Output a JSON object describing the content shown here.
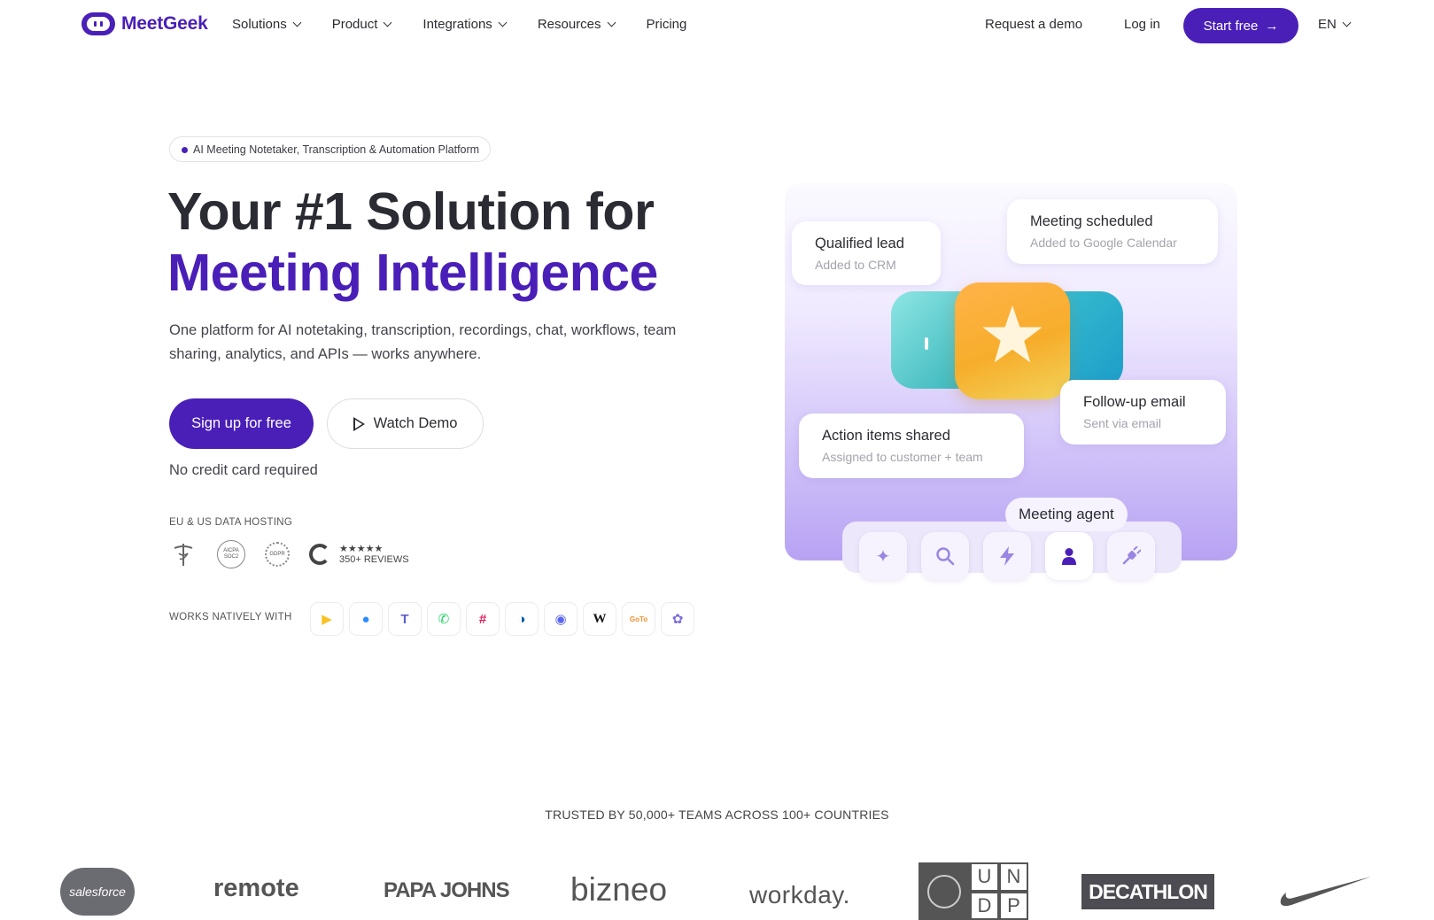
{
  "nav": {
    "brand": "MeetGeek",
    "menu": [
      {
        "label": "Solutions",
        "has_dropdown": true
      },
      {
        "label": "Product",
        "has_dropdown": true
      },
      {
        "label": "Integrations",
        "has_dropdown": true
      },
      {
        "label": "Resources",
        "has_dropdown": true
      },
      {
        "label": "Pricing",
        "has_dropdown": false
      }
    ],
    "request_demo": "Request a demo",
    "login": "Log in",
    "start_free": "Start free",
    "start_free_arrow": "→",
    "language": "EN"
  },
  "hero": {
    "pill": "AI Meeting Notetaker, Transcription & Automation Platform",
    "title_line1": "Your #1 Solution for",
    "title_line2": "Meeting Intelligence",
    "subtitle": "One platform for AI notetaking, transcription, recordings, chat, workflows, team sharing, analytics, and APIs — works anywhere.",
    "signup_button": "Sign up for free",
    "demo_button": "Watch Demo",
    "no_credit_card": "No credit card required",
    "hosting_label": "EU & US DATA HOSTING",
    "badges": {
      "hipaa": "HIPAA",
      "aicpa_line1": "AICPA",
      "aicpa_line2": "SOC2",
      "gdpr": "GDPR",
      "g2_stars": "★★★★★",
      "g2_reviews": "350+ REVIEWS"
    },
    "works_label": "WORKS NATIVELY WITH",
    "apps": [
      {
        "name": "google-meet",
        "glyph": "▶",
        "color": "#f8c224"
      },
      {
        "name": "zoom",
        "glyph": "●",
        "color": "#2d8cff"
      },
      {
        "name": "microsoft-teams",
        "glyph": "T",
        "color": "#5b5fc7"
      },
      {
        "name": "whatsapp",
        "glyph": "✆",
        "color": "#25d366"
      },
      {
        "name": "slack",
        "glyph": "#",
        "color": "#e01e5a"
      },
      {
        "name": "webex",
        "glyph": "◑",
        "color": "#0b5cad"
      },
      {
        "name": "discord",
        "glyph": "◉",
        "color": "#5865f2"
      },
      {
        "name": "wordpress",
        "glyph": "W",
        "color": "#111111"
      },
      {
        "name": "gotomeeting",
        "glyph": "GoTo",
        "color": "#f68d2e"
      },
      {
        "name": "zapier-like",
        "glyph": "✿",
        "color": "#7a6dd8"
      }
    ]
  },
  "visual": {
    "cards": {
      "qualified_title": "Qualified lead",
      "qualified_sub": "Added to CRM",
      "scheduled_title": "Meeting scheduled",
      "scheduled_sub": "Added to Google Calendar",
      "followup_title": "Follow-up email",
      "followup_sub": "Sent via email",
      "actions_title": "Action items shared",
      "actions_sub": "Assigned to customer + team"
    },
    "agent_label": "Meeting agent",
    "dock_icons": [
      "sparkles-icon",
      "search-icon",
      "bolt-icon",
      "person-icon",
      "plug-icon"
    ],
    "dock_active": "person-icon"
  },
  "trusted": {
    "heading": "TRUSTED BY 50,000+ TEAMS ACROSS 100+ COUNTRIES",
    "logos": [
      "salesforce",
      "remote",
      "PAPA JOHNS",
      "bizneo",
      "workday.",
      "U N D P",
      "DECATHLON",
      "nike"
    ]
  }
}
